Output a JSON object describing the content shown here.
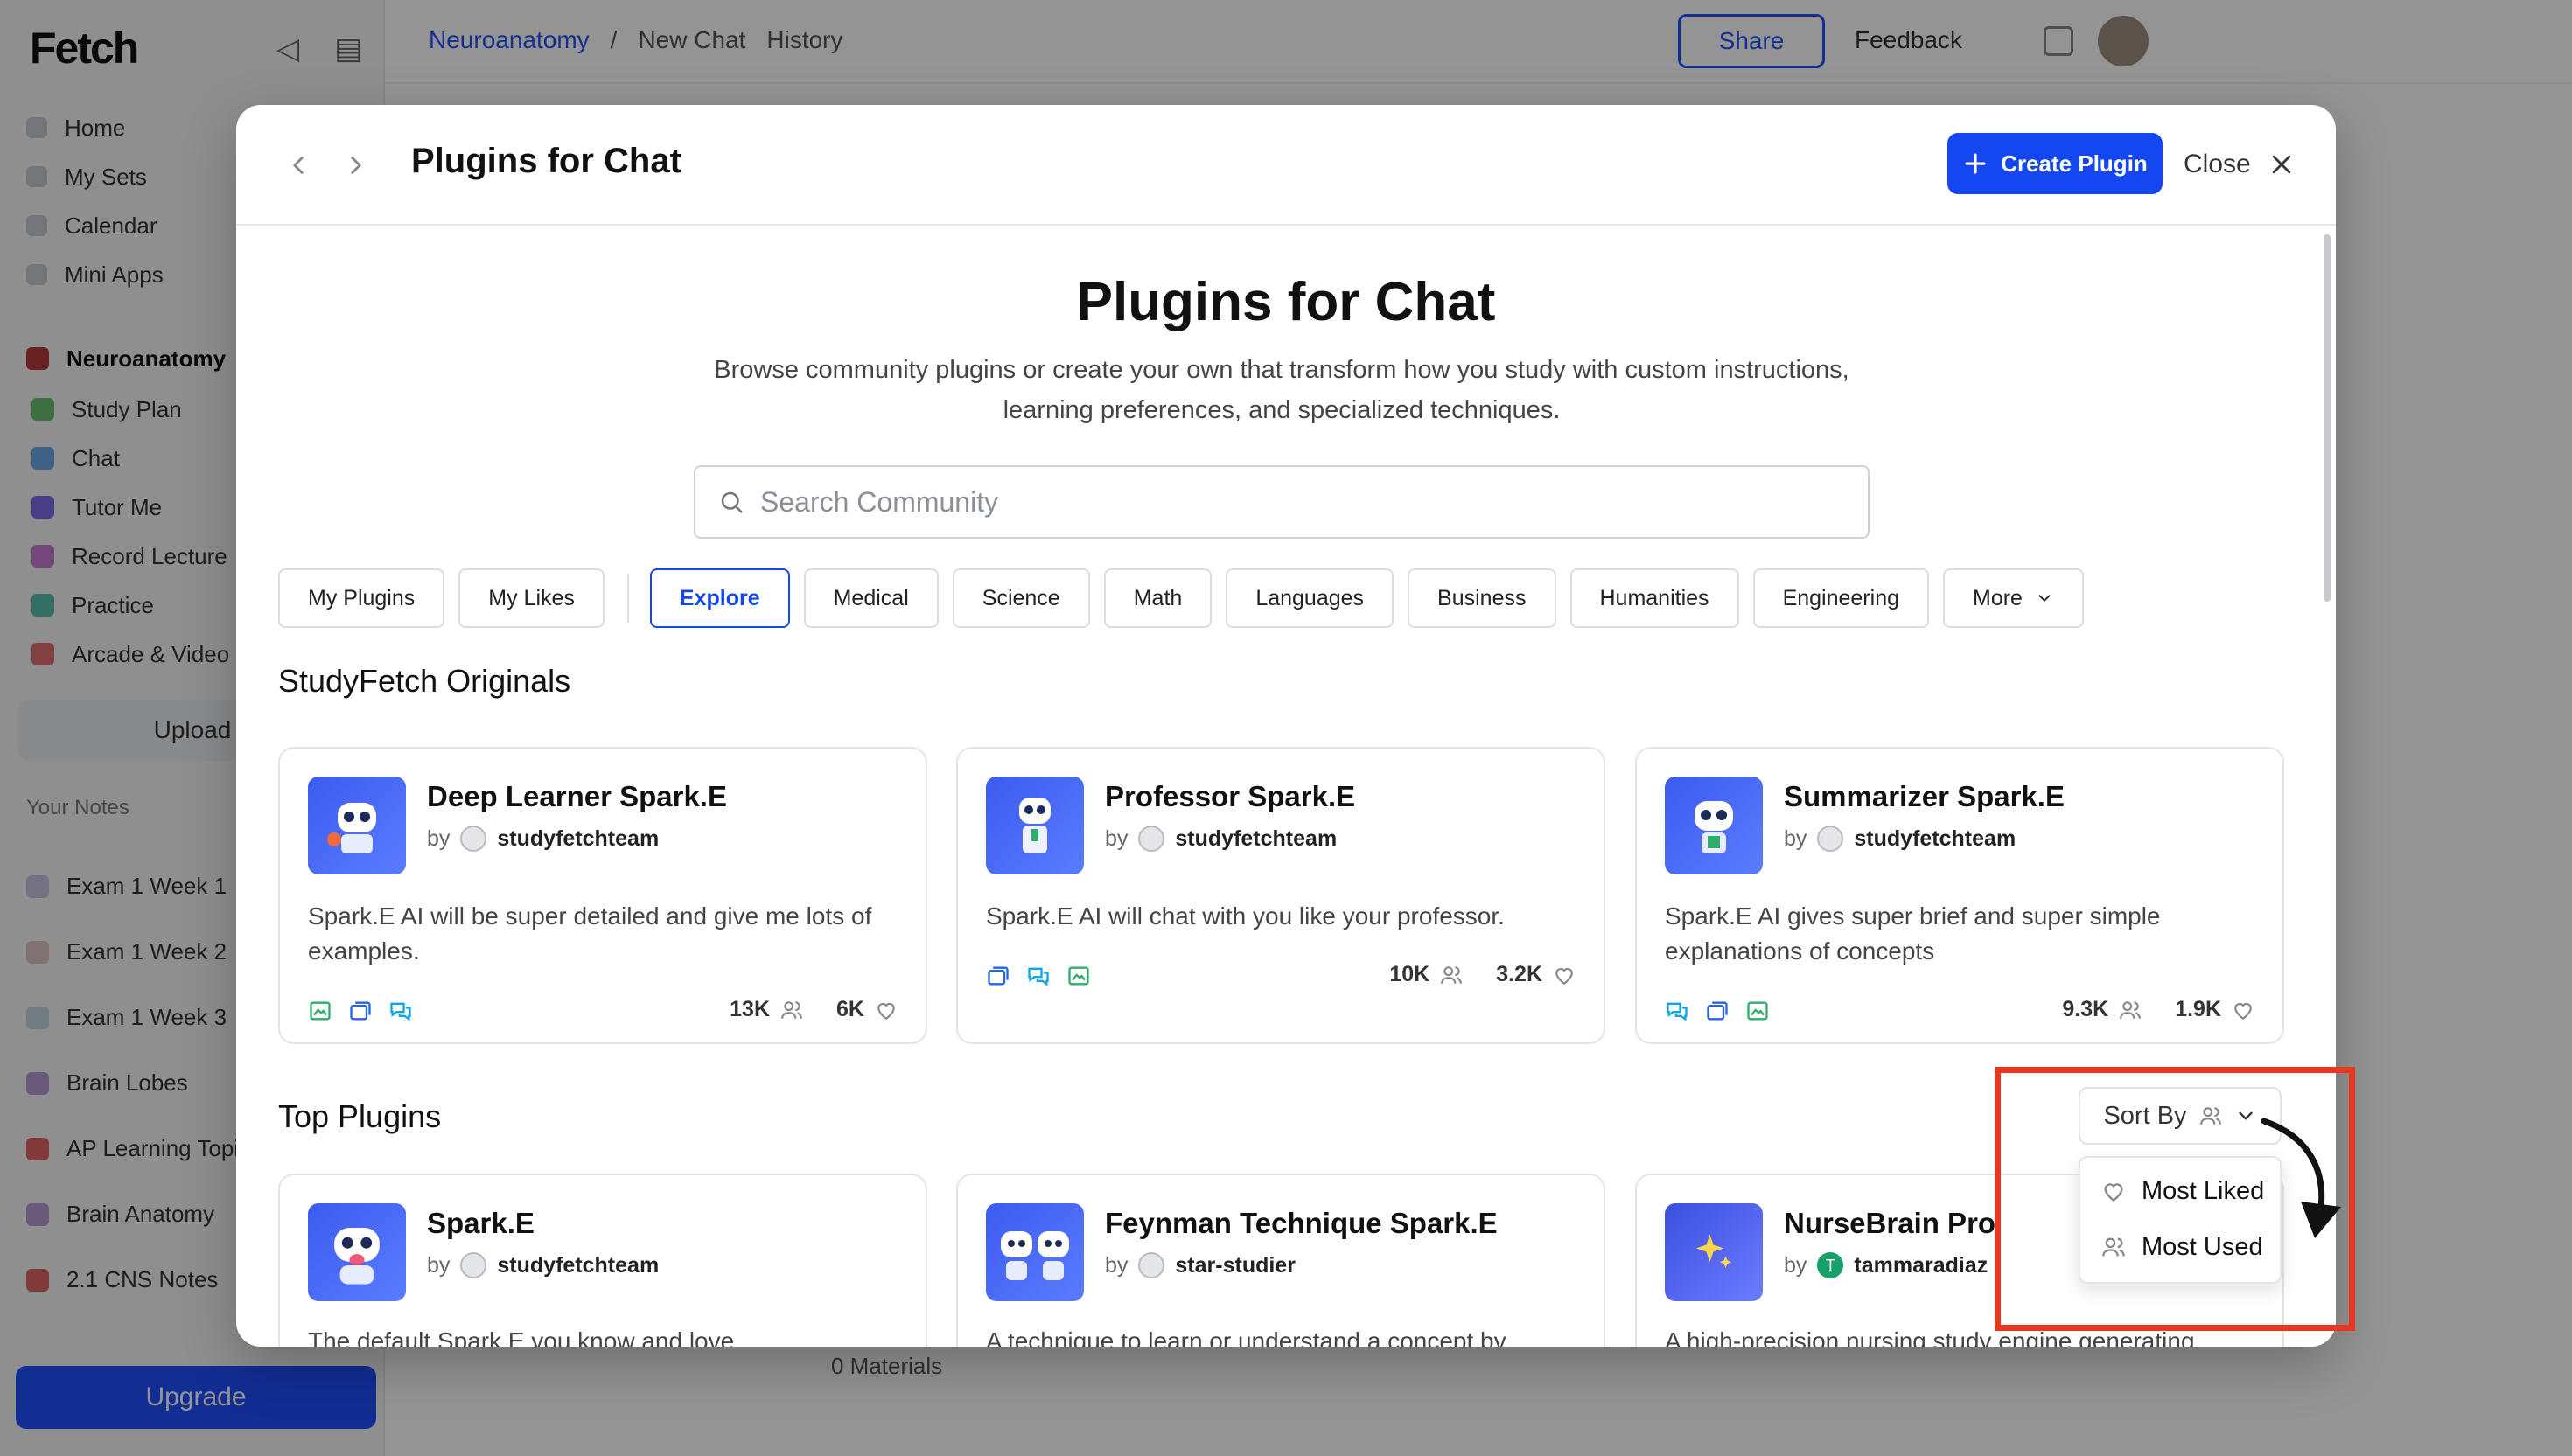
{
  "background": {
    "logo": "Fetch",
    "nav": [
      "Home",
      "My Sets",
      "Calendar",
      "Mini Apps"
    ],
    "group": {
      "title": "Neuroanatomy",
      "items": [
        "Study Plan",
        "Chat",
        "Tutor Me",
        "Record Lecture",
        "Practice",
        "Arcade & Video"
      ]
    },
    "upload_label": "Upload",
    "recent_title": "Your Notes",
    "recent_items": [
      "Exam 1 Week 1",
      "Exam 1 Week 2",
      "Exam 1 Week 3",
      "Brain Lobes",
      "AP Learning Topics",
      "Brain Anatomy",
      "2.1 CNS Notes"
    ],
    "upgrade_label": "Upgrade",
    "breadcrumbs": [
      "Neuroanatomy",
      "/",
      "New Chat",
      "History"
    ],
    "share_label": "Share",
    "feedback_label": "Feedback",
    "bottom_bar": [
      "0 Materials"
    ]
  },
  "modal": {
    "title": "Plugins for Chat",
    "create_label": "Create Plugin",
    "close_label": "Close",
    "hero_title": "Plugins for Chat",
    "hero_desc_line1": "Browse community plugins or create your own that transform how you study with custom instructions,",
    "hero_desc_line2": "learning preferences, and specialized techniques.",
    "search_placeholder": "Search Community",
    "tabs": {
      "my_plugins": "My Plugins",
      "my_likes": "My Likes",
      "explore": "Explore",
      "medical": "Medical",
      "science": "Science",
      "math": "Math",
      "languages": "Languages",
      "business": "Business",
      "humanities": "Humanities",
      "engineering": "Engineering",
      "more": "More"
    },
    "originals_title": "StudyFetch Originals",
    "originals": [
      {
        "title": "Deep Learner Spark.E",
        "by": "by",
        "author": "studyfetchteam",
        "desc": "Spark.E AI will be super detailed and give me lots of examples.",
        "uses": "13K",
        "likes": "6K"
      },
      {
        "title": "Professor Spark.E",
        "by": "by",
        "author": "studyfetchteam",
        "desc": "Spark.E AI will chat with you like your professor.",
        "uses": "10K",
        "likes": "3.2K"
      },
      {
        "title": "Summarizer Spark.E",
        "by": "by",
        "author": "studyfetchteam",
        "desc": "Spark.E AI gives super brief and super simple explanations of concepts",
        "uses": "9.3K",
        "likes": "1.9K"
      }
    ],
    "top_title": "Top Plugins",
    "sort_label": "Sort By",
    "sort_options": {
      "liked": "Most Liked",
      "used": "Most Used"
    },
    "top": [
      {
        "title": "Spark.E",
        "by": "by",
        "author": "studyfetchteam",
        "desc": "The default Spark.E you know and love."
      },
      {
        "title": "Feynman Technique Spark.E",
        "by": "by",
        "author": "star-studier",
        "desc": "A technique to learn or understand a concept by"
      },
      {
        "title": "NurseBrain Pro",
        "by": "by",
        "author": "tammaradiaz",
        "author_initial": "T",
        "desc": "A high-precision nursing study engine generating"
      }
    ]
  },
  "colors": {
    "primary": "#1447ef",
    "annotation": "#e9371f"
  }
}
